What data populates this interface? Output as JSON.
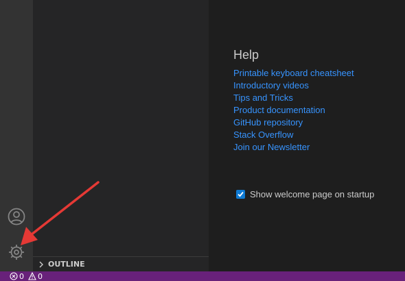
{
  "help": {
    "title": "Help",
    "links": [
      "Printable keyboard cheatsheet",
      "Introductory videos",
      "Tips and Tricks",
      "Product documentation",
      "GitHub repository",
      "Stack Overflow",
      "Join our Newsletter"
    ]
  },
  "startup": {
    "label": "Show welcome page on startup",
    "checked": true
  },
  "sidebar": {
    "outline_label": "OUTLINE"
  },
  "statusbar": {
    "errors": "0",
    "warnings": "0"
  },
  "activity_bar": {
    "icons": [
      "account-icon",
      "gear-icon"
    ]
  },
  "colors": {
    "link": "#3794ff",
    "statusbar": "#68217a",
    "checkbox": "#0e7ad3",
    "annotation_arrow": "#e53935"
  }
}
